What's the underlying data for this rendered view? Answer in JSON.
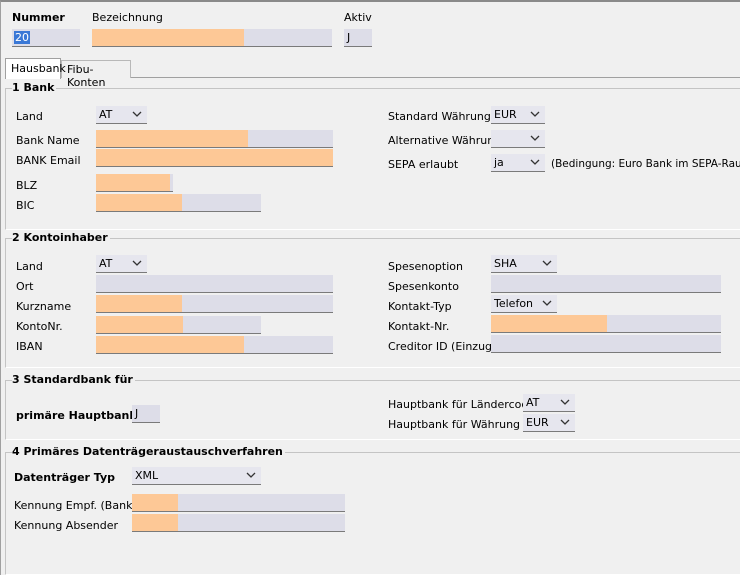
{
  "header": {
    "nummer_label": "Nummer",
    "nummer_value": "20",
    "bezeichnung_label": "Bezeichnung",
    "bezeichnung_value": "",
    "aktiv_label": "Aktiv",
    "aktiv_value": "J"
  },
  "tabs": [
    {
      "label": "Hausbank",
      "active": true
    },
    {
      "label": "Fibu-Konten",
      "active": false
    }
  ],
  "section_bank": {
    "title": "1 Bank",
    "land_label": "Land",
    "land_value": "AT",
    "bank_name_label": "Bank Name",
    "bank_email_label": "BANK Email",
    "blz_label": "BLZ",
    "bic_label": "BIC",
    "standard_waehrung_label": "Standard Währung",
    "standard_waehrung_value": "EUR",
    "alternative_waehrung_label": "Alternative Währung",
    "alternative_waehrung_value": "",
    "sepa_label": "SEPA erlaubt",
    "sepa_value": "ja",
    "sepa_note": "(Bedingung: Euro Bank im SEPA-Raum)"
  },
  "section_kontoinhaber": {
    "title": "2 Kontoinhaber",
    "land_label": "Land",
    "land_value": "AT",
    "ort_label": "Ort",
    "kurzname_label": "Kurzname",
    "kontonr_label": "KontoNr.",
    "iban_label": "IBAN",
    "spesenoption_label": "Spesenoption",
    "spesenoption_value": "SHA",
    "spesenkonto_label": "Spesenkonto",
    "kontakt_typ_label": "Kontakt-Typ",
    "kontakt_typ_value": "Telefon",
    "kontakt_nr_label": "Kontakt-Nr.",
    "creditor_id_label": "Creditor ID (Einzug)"
  },
  "section_standardbank": {
    "title": "3 Standardbank für",
    "primaere_label": "primäre Hauptbank",
    "primaere_value": "J",
    "laendercode_label": "Hauptbank für Ländercode",
    "laendercode_value": "AT",
    "waehrung_label": "Hauptbank für Währung",
    "waehrung_value": "EUR"
  },
  "section_dta": {
    "title": "4 Primäres Datenträgeraustauschverfahren",
    "typ_label": "Datenträger Typ",
    "typ_value": "XML",
    "kennung_empf_label": "Kennung Empf. (Bank)",
    "kennung_absender_label": "Kennung Absender"
  },
  "colors": {
    "required_fill": "#fdc896",
    "field_bg": "#dddde8",
    "window_bg": "#f0f0f0",
    "selection": "#3a78d6"
  }
}
